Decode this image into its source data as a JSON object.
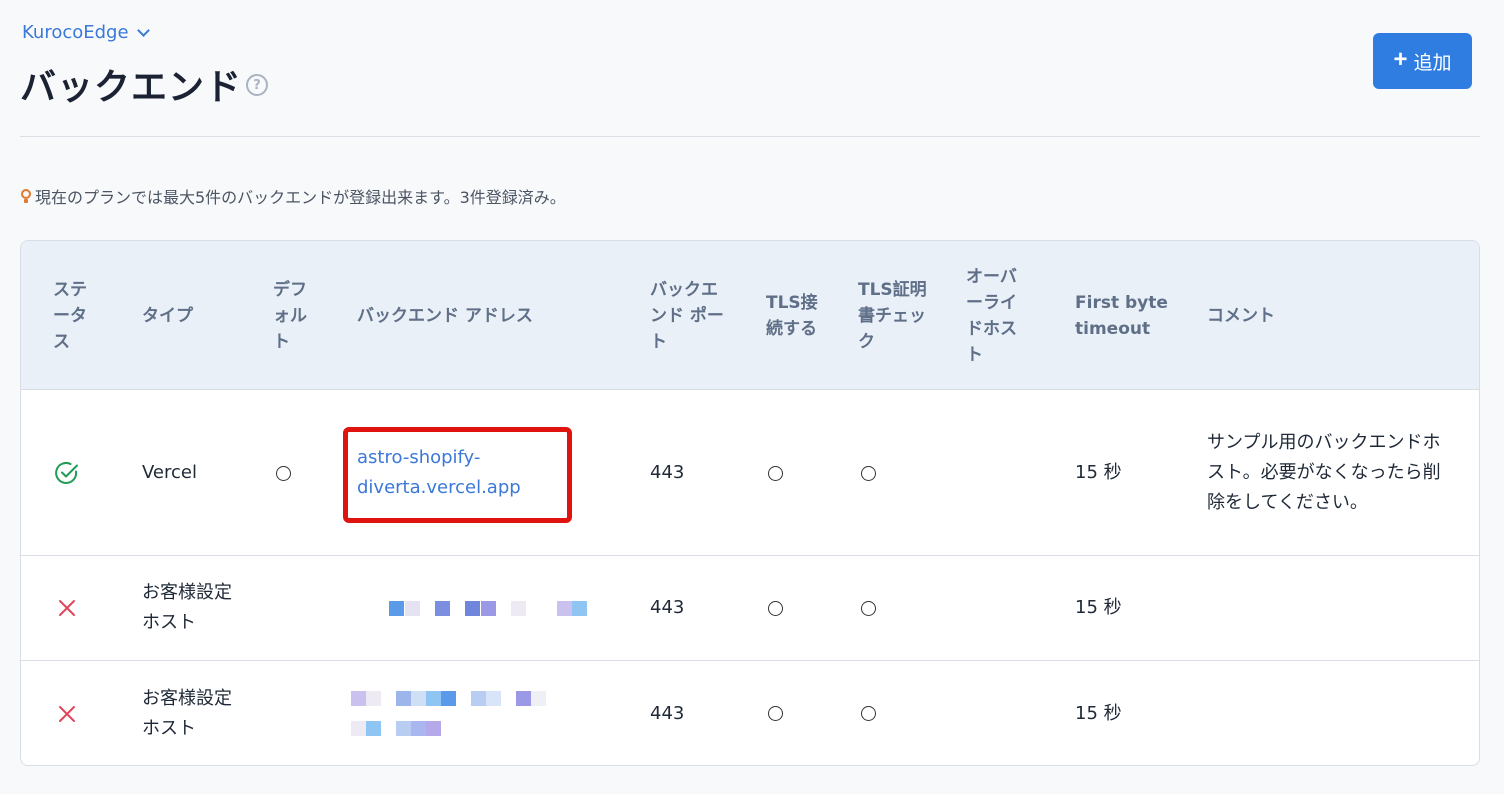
{
  "breadcrumb": {
    "label": "KurocoEdge"
  },
  "page": {
    "title": "バックエンド"
  },
  "help": {
    "symbol": "?"
  },
  "toolbar": {
    "add_label": "追加",
    "add_symbol": "+"
  },
  "notice": {
    "text": "現在のプランでは最大5件のバックエンドが登録出来ます。3件登録済み。"
  },
  "table": {
    "headers": {
      "status": "ステータス",
      "type": "タイプ",
      "default": "デフォルト",
      "address": "バックエンド アドレス",
      "port": "バックエンド ポート",
      "tls": "TLS接続する",
      "tls_check": "TLS証明書チェック",
      "override_host": "オーバーライドホスト",
      "first_byte": "First byte timeout",
      "comment": "コメント"
    },
    "rows": [
      {
        "status": "ok",
        "type": "Vercel",
        "default": "○",
        "address": "astro-shopify-diverta.vercel.app",
        "port": "443",
        "tls": "○",
        "tls_check": "○",
        "override_host": "",
        "first_byte": "15 秒",
        "comment": "サンプル用のバックエンドホスト。必要がなくなったら削除をしてください。"
      },
      {
        "status": "error",
        "type": "お客様設定ホスト",
        "default": "",
        "address": "",
        "port": "443",
        "tls": "○",
        "tls_check": "○",
        "override_host": "",
        "first_byte": "15 秒",
        "comment": ""
      },
      {
        "status": "error",
        "type": "お客様設定ホスト",
        "default": "",
        "address": "",
        "port": "443",
        "tls": "○",
        "tls_check": "○",
        "override_host": "",
        "first_byte": "15 秒",
        "comment": ""
      }
    ]
  },
  "colors": {
    "accent": "#2f7de1",
    "link": "#3b78d8",
    "status_ok": "#1f9d55",
    "status_error": "#e0455a",
    "highlight": "#e0140f"
  }
}
